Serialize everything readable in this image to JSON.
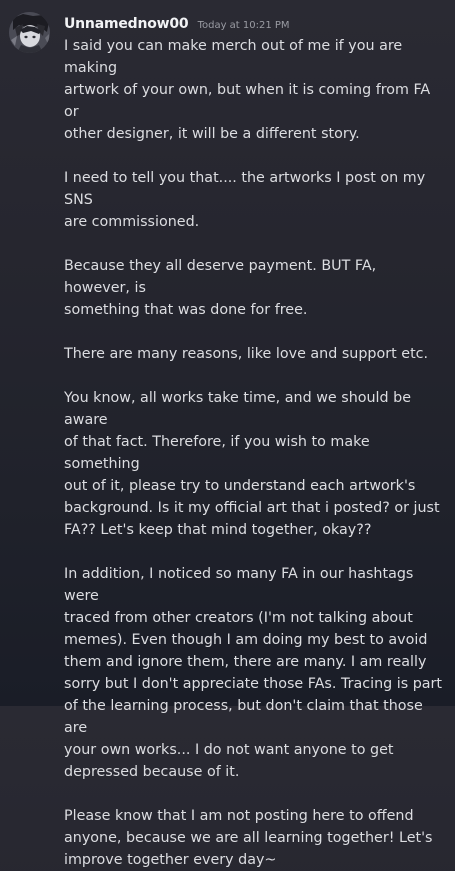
{
  "message": {
    "username": "Unnamednow00",
    "timestamp": "Today at 10:21 PM",
    "paragraphs": [
      "I said you can make merch out of me if you are making\nartwork of your own, but when it is coming from FA or\nother designer, it will be a different story.",
      "I need to tell you that.... the artworks I post on my SNS\nare commissioned.",
      "Because they all deserve payment. BUT FA, however, is\nsomething that was done for free.",
      "There are many reasons, like love and support etc.",
      "You know, all works take time, and we should be aware\nof that fact. Therefore, if you wish to make something\nout of it, please try to understand each artwork's\nbackground. Is it my official art that i posted? or just\nFA?? Let's keep that mind together, okay??",
      "In addition, I noticed so many FA in our hashtags were\ntraced from other creators (I'm not talking about\nmemes). Even though I am doing my best to avoid\nthem and ignore them, there are many. I am really\nsorry but I don't appreciate those FAs. Tracing is part\nof the learning process, but don't claim that those are\nyour own works... I do not want anyone to get\ndepressed because of it.",
      "Please know that I am not posting here to offend\nanyone, because we are all learning together! Let's\nimprove together every day~"
    ]
  },
  "colors": {
    "background": "#23242d",
    "username": "#f2f3f5",
    "timestamp": "#9a9ca3",
    "text": "#dcdde1"
  }
}
